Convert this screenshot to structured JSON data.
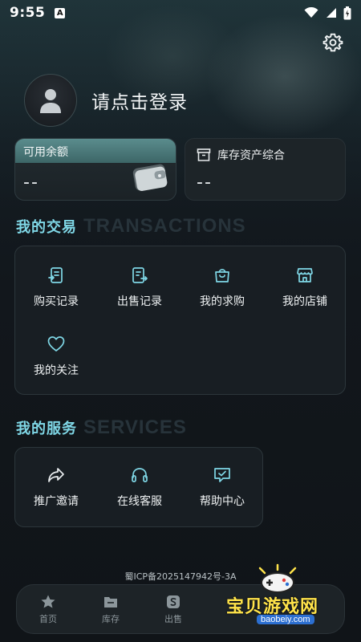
{
  "status": {
    "time": "9:55",
    "notif_glyph": "A"
  },
  "profile": {
    "login_text": "请点击登录"
  },
  "balance": {
    "label": "可用余额",
    "value": "--"
  },
  "assets": {
    "label": "库存资产综合",
    "value": "--"
  },
  "transactions": {
    "title_cn": "我的交易",
    "title_en": "TRANSACTIONS",
    "items": [
      {
        "label": "购买记录",
        "icon": "purchase-record-icon"
      },
      {
        "label": "出售记录",
        "icon": "sale-record-icon"
      },
      {
        "label": "我的求购",
        "icon": "shopping-bag-icon"
      },
      {
        "label": "我的店铺",
        "icon": "store-icon"
      },
      {
        "label": "我的关注",
        "icon": "heart-icon"
      }
    ]
  },
  "services": {
    "title_cn": "我的服务",
    "title_en": "SERVICES",
    "items": [
      {
        "label": "推广邀请",
        "icon": "share-icon"
      },
      {
        "label": "在线客服",
        "icon": "headset-icon"
      },
      {
        "label": "帮助中心",
        "icon": "help-chat-icon"
      }
    ]
  },
  "footer": {
    "icp": "蜀ICP备2025147942号-3A"
  },
  "tabs": [
    {
      "label": "首页",
      "icon": "home-icon"
    },
    {
      "label": "库存",
      "icon": "inventory-icon"
    },
    {
      "label": "出售",
      "icon": "sell-icon"
    }
  ],
  "watermark": {
    "title": "宝贝游戏网",
    "url": "baobeiy.com"
  },
  "colors": {
    "accent": "#7fd7e6",
    "balance_header": "#4f7f80",
    "background": "#12171c"
  }
}
